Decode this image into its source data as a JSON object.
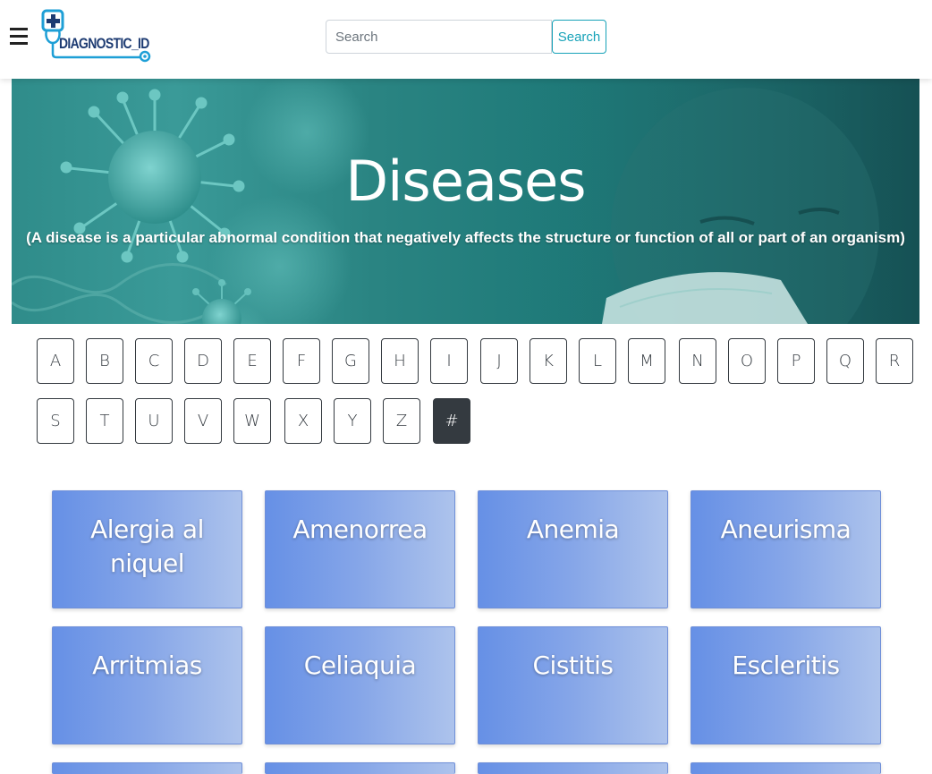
{
  "header": {
    "logo_text": "DIAGNOSTIC_ID",
    "search_placeholder": "Search",
    "search_button": "Search"
  },
  "hero": {
    "title": "Diseases",
    "subtitle": "(A disease is a particular abnormal condition that negatively affects the structure or function of all or part of an organism)"
  },
  "alphabet": [
    "A",
    "B",
    "C",
    "D",
    "E",
    "F",
    "G",
    "H",
    "I",
    "J",
    "K",
    "L",
    "M",
    "N",
    "O",
    "P",
    "Q",
    "R",
    "S",
    "T",
    "U",
    "V",
    "W",
    "X",
    "Y",
    "Z",
    "#"
  ],
  "active_letter": "#",
  "diseases": [
    "Alergia al niquel",
    "Amenorrea",
    "Anemia",
    "Aneurisma",
    "Arritmias",
    "Celiaquia",
    "Cistitis",
    "Escleritis"
  ],
  "colors": {
    "dark": "#343a40",
    "info": "#17a2b8",
    "card_start": "#6690e6",
    "card_end": "#adc3ec",
    "hero": "#1f7a79"
  }
}
